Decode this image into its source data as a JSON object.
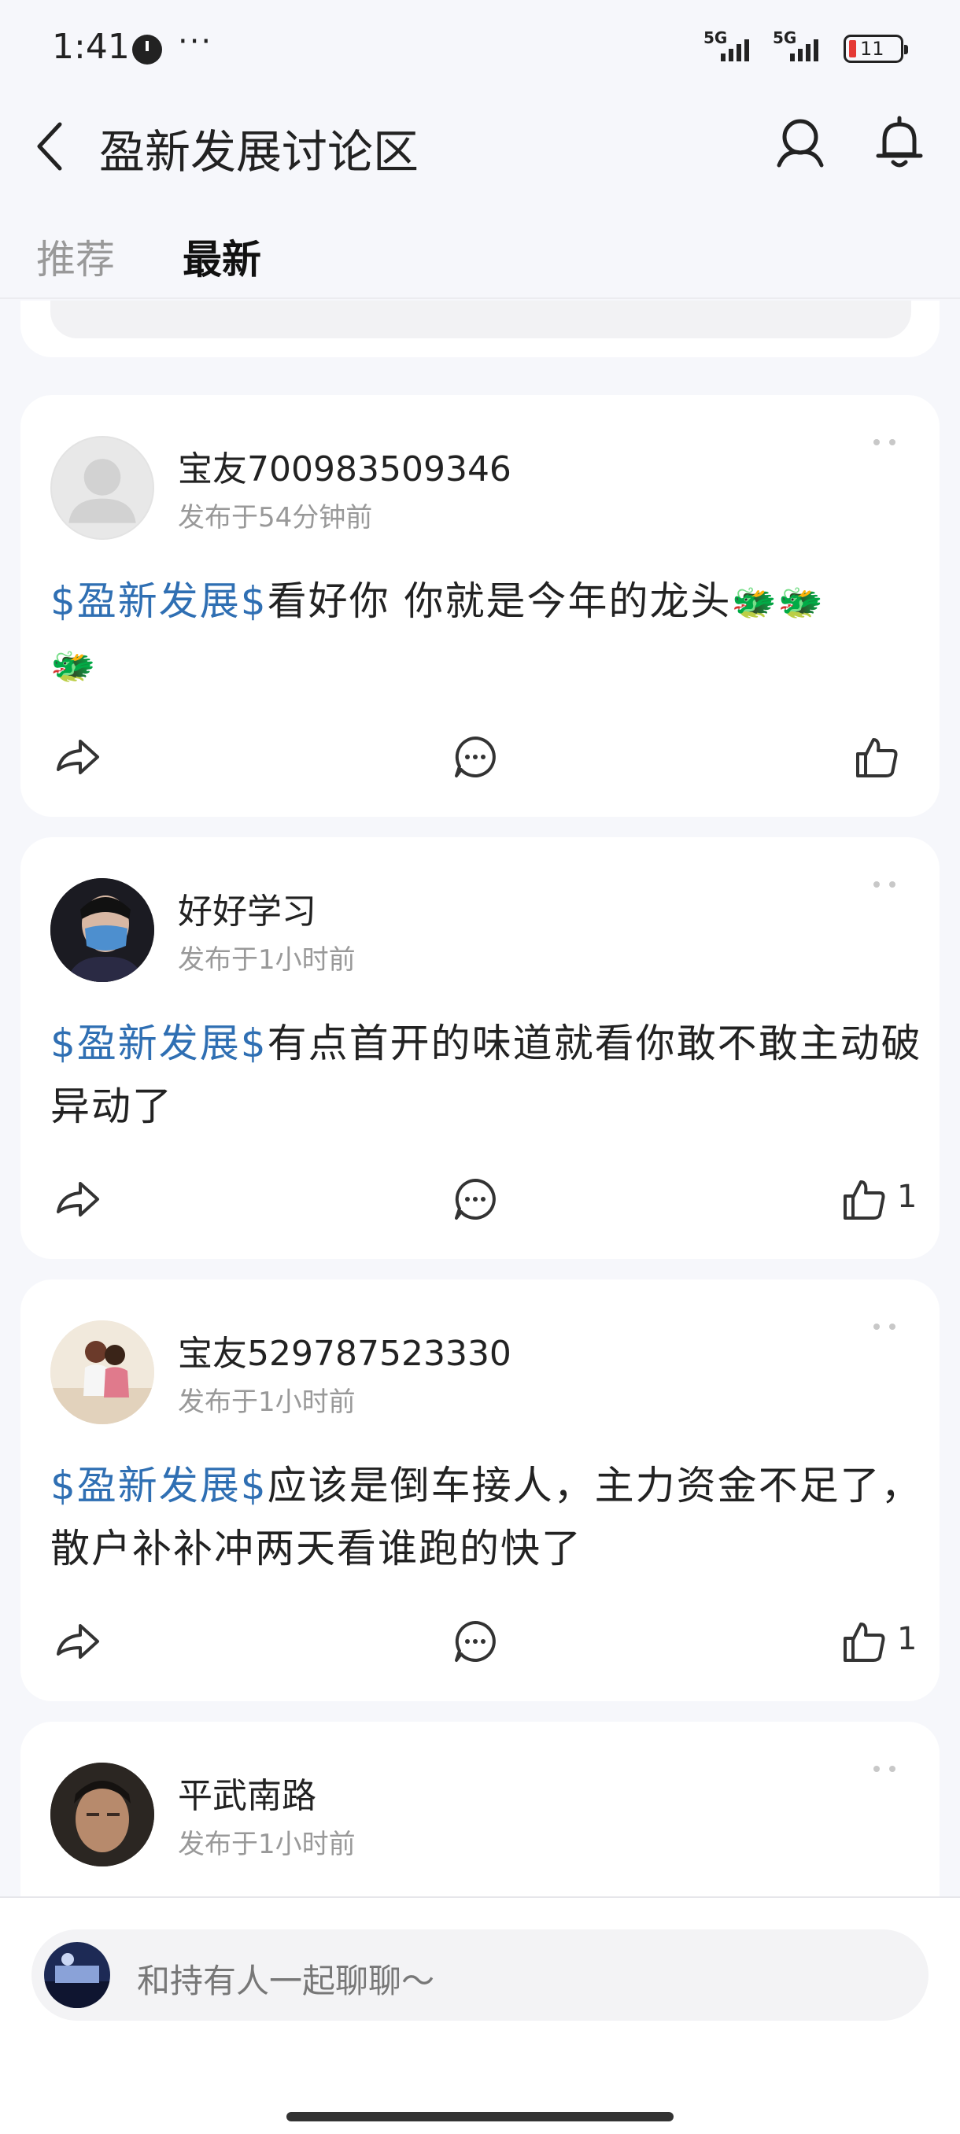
{
  "status": {
    "time": "1:41",
    "more": "···",
    "net1": "5G",
    "net2": "5G",
    "battery": "11"
  },
  "header": {
    "title": "盈新发展讨论区"
  },
  "tabs": [
    {
      "label": "推荐"
    },
    {
      "label": "最新"
    }
  ],
  "posts": [
    {
      "username": "宝友700983509346",
      "time": "发布于54分钟前",
      "tag": "$盈新发展$",
      "text": "看好你 你就是今年的龙头",
      "emoji": "🐲",
      "likes": ""
    },
    {
      "username": "好好学习",
      "time": "发布于1小时前",
      "tag": "$盈新发展$",
      "text": "有点首开的味道就看你敢不敢主动破异动了",
      "likes": "1"
    },
    {
      "username": "宝友529787523330",
      "time": "发布于1小时前",
      "tag": "$盈新发展$",
      "text": "应该是倒车接人，主力资金不足了，散户补补冲两天看谁跑的快了",
      "likes": "1"
    },
    {
      "username": "平武南路",
      "time": "发布于1小时前"
    }
  ],
  "chat": {
    "placeholder": "和持有人一起聊聊～"
  },
  "colors": {
    "accent": "#2f6fb3",
    "background": "#f6f7fb"
  }
}
